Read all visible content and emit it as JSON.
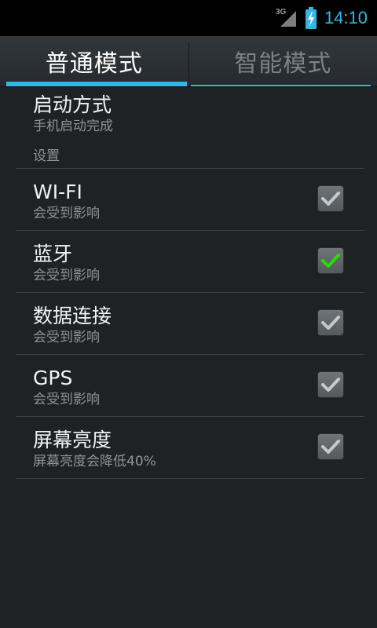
{
  "status_bar": {
    "network_label": "3G",
    "clock": "14:10",
    "accent_color": "#33b5e5"
  },
  "tabs": [
    {
      "label": "普通模式",
      "active": true
    },
    {
      "label": "智能模式",
      "active": false
    }
  ],
  "start_mode": {
    "title": "启动方式",
    "subtitle": "手机启动完成"
  },
  "settings": {
    "header": "设置",
    "items": [
      {
        "title": "WI-FI",
        "subtitle": "会受到影响",
        "checked": true,
        "check_color": "#c8c8c8"
      },
      {
        "title": "蓝牙",
        "subtitle": "会受到影响",
        "checked": true,
        "check_color": "#22e000"
      },
      {
        "title": "数据连接",
        "subtitle": "会受到影响",
        "checked": true,
        "check_color": "#c8c8c8"
      },
      {
        "title": "GPS",
        "subtitle": "会受到影响",
        "checked": true,
        "check_color": "#c8c8c8"
      },
      {
        "title": "屏幕亮度",
        "subtitle": "屏幕亮度会降低40%",
        "checked": true,
        "check_color": "#c8c8c8"
      }
    ]
  },
  "icons": {
    "signal": "signal-icon",
    "battery": "battery-charging-icon",
    "check": "check-icon"
  }
}
